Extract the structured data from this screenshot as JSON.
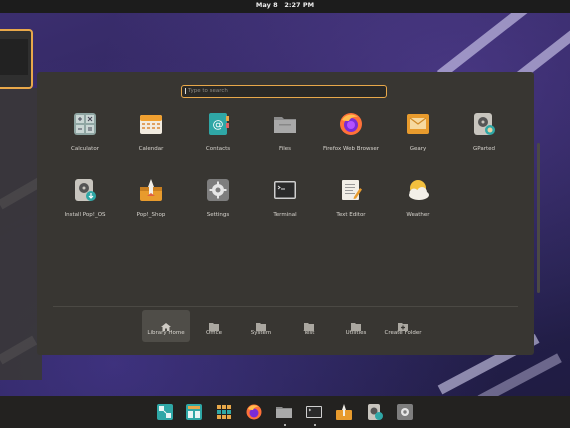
{
  "topbar": {
    "date": "May 8",
    "time": "2:27 PM"
  },
  "search": {
    "placeholder": "Type to search"
  },
  "apps": [
    {
      "label": "Calculator",
      "icon": "calculator-icon"
    },
    {
      "label": "Calendar",
      "icon": "calendar-icon"
    },
    {
      "label": "Contacts",
      "icon": "contacts-icon"
    },
    {
      "label": "Files",
      "icon": "files-icon"
    },
    {
      "label": "Firefox Web Browser",
      "icon": "firefox-icon"
    },
    {
      "label": "Geary",
      "icon": "geary-mail-icon"
    },
    {
      "label": "GParted",
      "icon": "gparted-icon"
    },
    {
      "label": "Install Pop!_OS",
      "icon": "install-popos-icon"
    },
    {
      "label": "Pop!_Shop",
      "icon": "pop-shop-icon"
    },
    {
      "label": "Settings",
      "icon": "settings-gear-icon"
    },
    {
      "label": "Terminal",
      "icon": "terminal-icon"
    },
    {
      "label": "Text Editor",
      "icon": "text-editor-icon"
    },
    {
      "label": "Weather",
      "icon": "weather-icon"
    }
  ],
  "folders": [
    {
      "label": "Library Home",
      "icon": "home-icon"
    },
    {
      "label": "Office",
      "icon": "folder-icon"
    },
    {
      "label": "System",
      "icon": "folder-icon"
    },
    {
      "label": "Test",
      "icon": "folder-icon"
    },
    {
      "label": "Utilities",
      "icon": "folder-icon"
    },
    {
      "label": "Create Folder",
      "icon": "create-folder-icon"
    }
  ],
  "dock": [
    "workspaces-icon",
    "application-library-icon",
    "launcher-grid-icon",
    "firefox-icon",
    "files-icon",
    "terminal-icon",
    "pop-shop-icon",
    "gparted-icon",
    "settings-gear-icon"
  ],
  "colors": {
    "accent": "#e8a84a",
    "panel": "#383632",
    "topbar": "#1c1c1c",
    "dock": "#232220"
  }
}
